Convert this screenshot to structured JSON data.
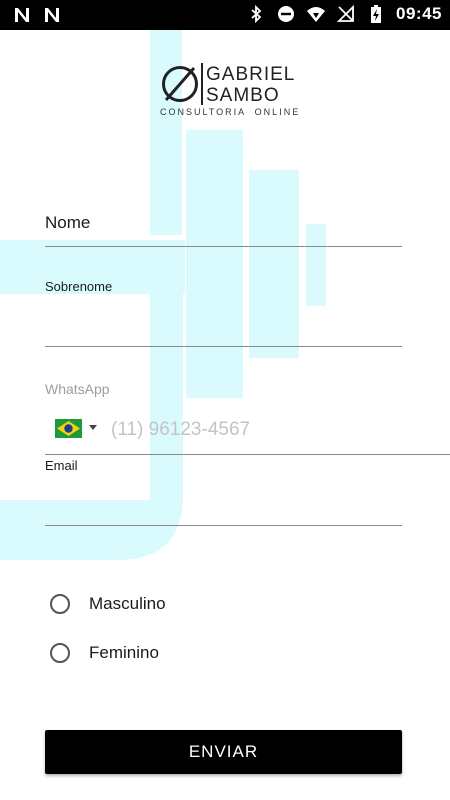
{
  "status_bar": {
    "time": "09:45",
    "left_icons": [
      "notification-n-icon",
      "notification-n-icon"
    ],
    "right_icons": [
      "bluetooth-icon",
      "do-not-disturb-icon",
      "wifi-icon",
      "signal-off-icon",
      "battery-charging-icon"
    ]
  },
  "logo": {
    "line1": "GABRIEL",
    "line2": "SAMBO",
    "subtitle": "CONSULTORIA  ONLINE"
  },
  "form": {
    "nome_label": "Nome",
    "sobrenome_label": "Sobrenome",
    "whatsapp_label": "WhatsApp",
    "whatsapp_placeholder": "(11) 96123-4567",
    "whatsapp_country": "Brazil",
    "email_label": "Email",
    "gender_options": [
      "Masculino",
      "Feminino"
    ],
    "submit_label": "ENVIAR"
  },
  "colors": {
    "accent_bg": "#d9fbfd",
    "button": "#000000",
    "status_bar": "#000000"
  }
}
